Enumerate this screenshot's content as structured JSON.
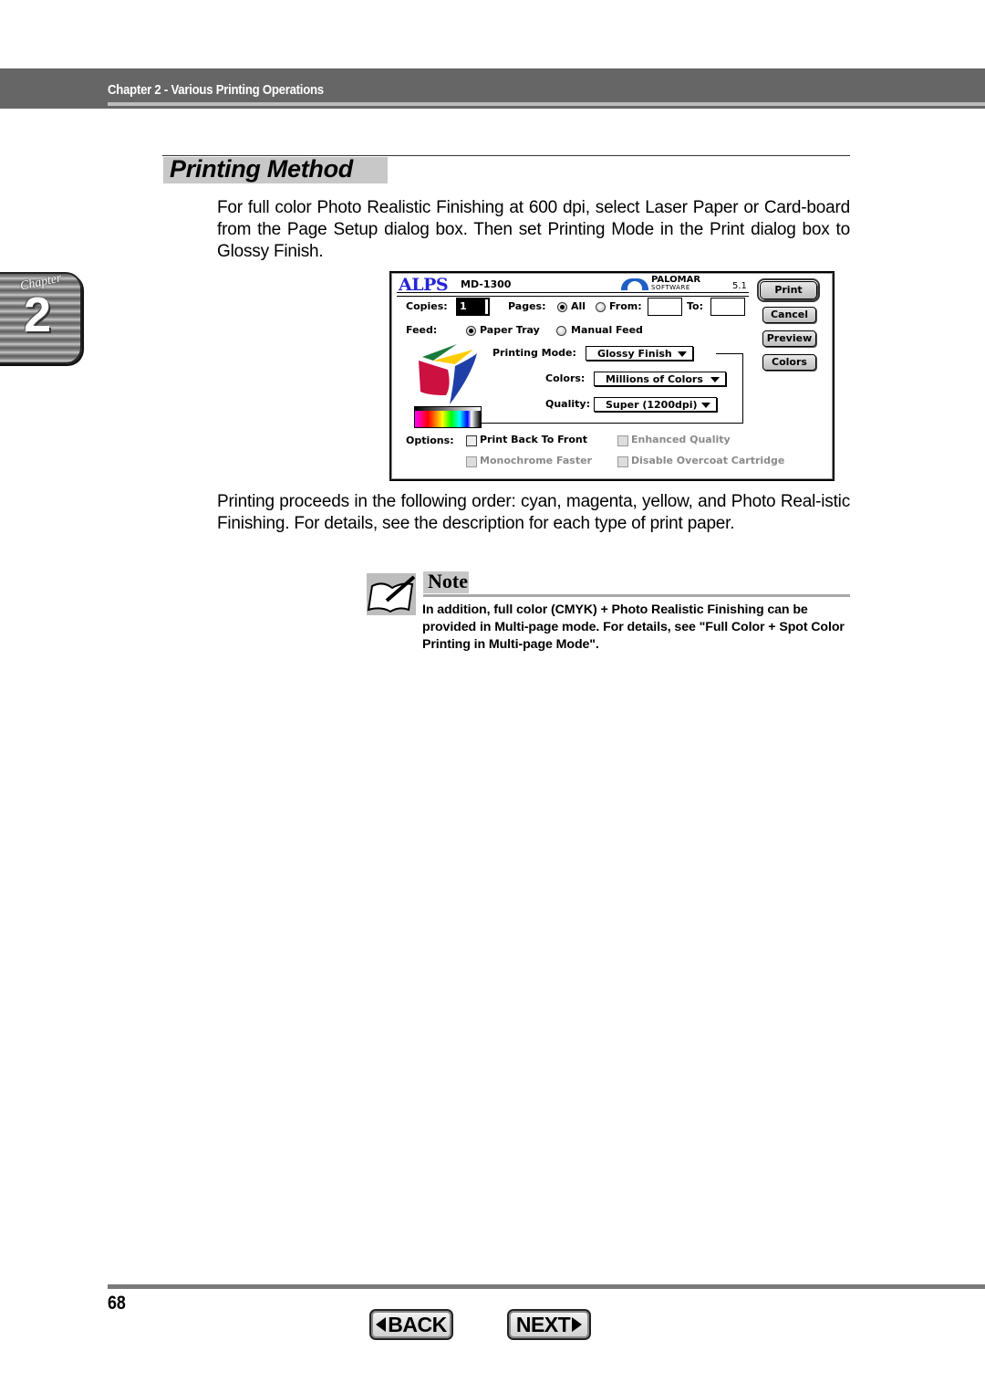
{
  "header": {
    "chapter_title": "Chapter 2 - Various Printing Operations"
  },
  "chapter_tab": {
    "word": "Chapter",
    "number": "2"
  },
  "section": {
    "title": "Printing Method",
    "paragraph1": "For full color Photo Realistic Finishing at 600 dpi, select Laser Paper or Card-board from the Page Setup dialog box. Then set Printing Mode in the Print dialog box to Glossy Finish.",
    "paragraph2": "Printing proceeds in the following order: cyan, magenta, yellow, and Photo Real-istic Finishing. For details, see the description for each type of print paper."
  },
  "print_dialog": {
    "brand": "ALPS",
    "model": "MD-1300",
    "vendor": "PALOMAR",
    "vendor_sub": "SOFTWARE",
    "version": "5.1",
    "copies_label": "Copies:",
    "copies_value": "1",
    "pages_label": "Pages:",
    "pages_all": "All",
    "pages_from": "From:",
    "pages_to": "To:",
    "from_value": "",
    "to_value": "",
    "pages_selected": "All",
    "feed_label": "Feed:",
    "feed_paper_tray": "Paper Tray",
    "feed_manual": "Manual Feed",
    "feed_selected": "Paper Tray",
    "printing_mode_label": "Printing Mode:",
    "printing_mode_value": "Glossy Finish",
    "colors_label": "Colors:",
    "colors_value": "Millions of Colors",
    "quality_label": "Quality:",
    "quality_value": "Super (1200dpi)",
    "options_label": "Options:",
    "options": [
      {
        "label": "Print Back To Front",
        "checked": false,
        "enabled": true
      },
      {
        "label": "Enhanced Quality",
        "checked": false,
        "enabled": false
      },
      {
        "label": "Monochrome Faster",
        "checked": false,
        "enabled": false
      },
      {
        "label": "Disable Overcoat Cartridge",
        "checked": false,
        "enabled": false
      }
    ],
    "buttons": {
      "print": "Print",
      "cancel": "Cancel",
      "preview": "Preview",
      "colors": "Colors"
    },
    "brand_color": "#2424d8"
  },
  "note": {
    "label": "Note",
    "text": "In addition, full color (CMYK) + Photo Realistic Finishing can be provided in Multi-page mode. For details, see \"Full Color + Spot Color Printing in Multi-page Mode\"."
  },
  "footer": {
    "page_number": "68",
    "back_label": "BACK",
    "next_label": "NEXT"
  }
}
